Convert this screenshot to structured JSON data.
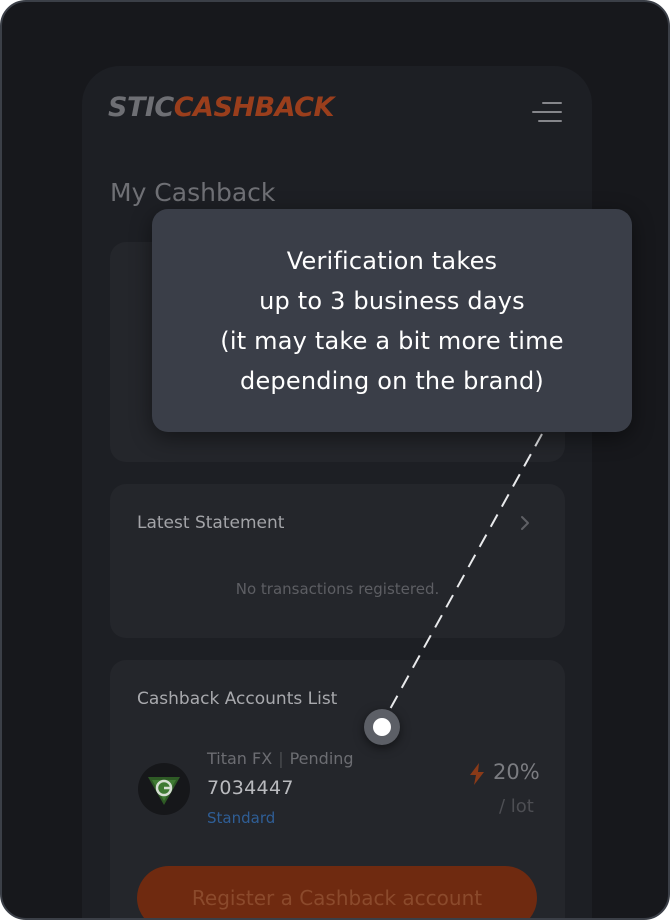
{
  "header": {
    "logo_prefix": "STIC",
    "logo_brand": "CASHBACK",
    "menu_icon": "hamburger-menu-icon"
  },
  "page": {
    "title": "My Cashback"
  },
  "statement": {
    "title": "Latest Statement",
    "empty_message": "No transactions registered."
  },
  "accounts": {
    "title": "Cashback Accounts List",
    "items": [
      {
        "broker": "Titan FX",
        "status": "Pending",
        "number": "7034447",
        "type": "Standard",
        "rate": "20%",
        "rate_unit": "/ lot"
      }
    ],
    "register_label": "Register a Cashback account"
  },
  "tooltip": {
    "lines": [
      "Verification takes",
      "up to 3 business days",
      "(it may take a bit more time",
      "depending on the brand)"
    ]
  },
  "colors": {
    "accent": "#e8622c",
    "link": "#3d7fd1",
    "background": "#17181c",
    "tooltip_bg": "#3a3e48"
  }
}
